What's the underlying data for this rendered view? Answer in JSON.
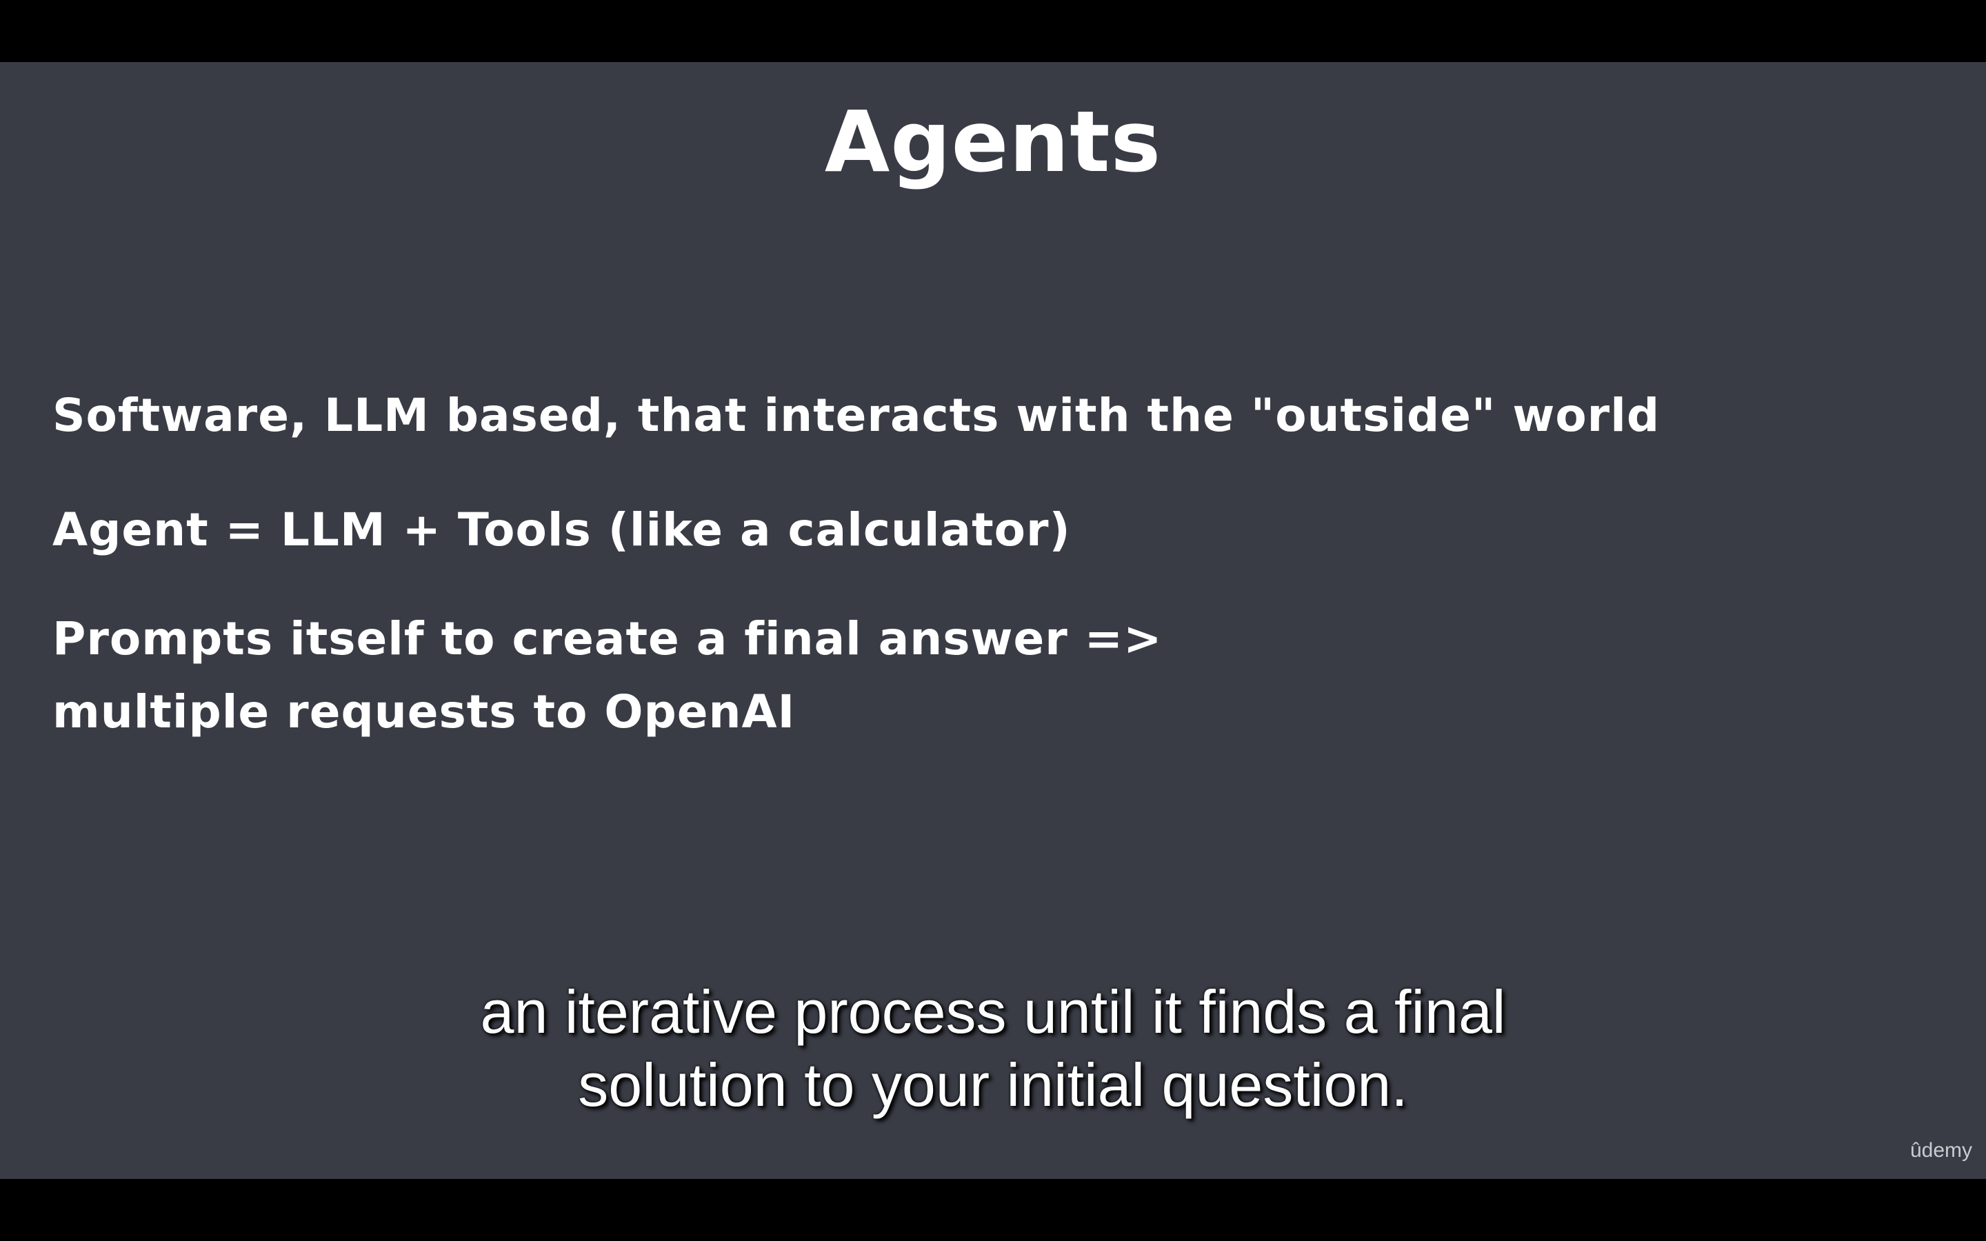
{
  "slide": {
    "title": "Agents",
    "bullets": [
      "Software, LLM based, that interacts with the \"outside\" world",
      "Agent = LLM + Tools (like a calculator)",
      "Prompts itself to create a final answer =>",
      "multiple requests to OpenAI"
    ]
  },
  "captions": {
    "line1": "an iterative process until it finds a final",
    "line2": "solution to your initial question."
  },
  "watermark": "ûdemy",
  "colors": {
    "slide_background": "#393c45",
    "letterbox": "#000000",
    "text": "#ffffff"
  }
}
